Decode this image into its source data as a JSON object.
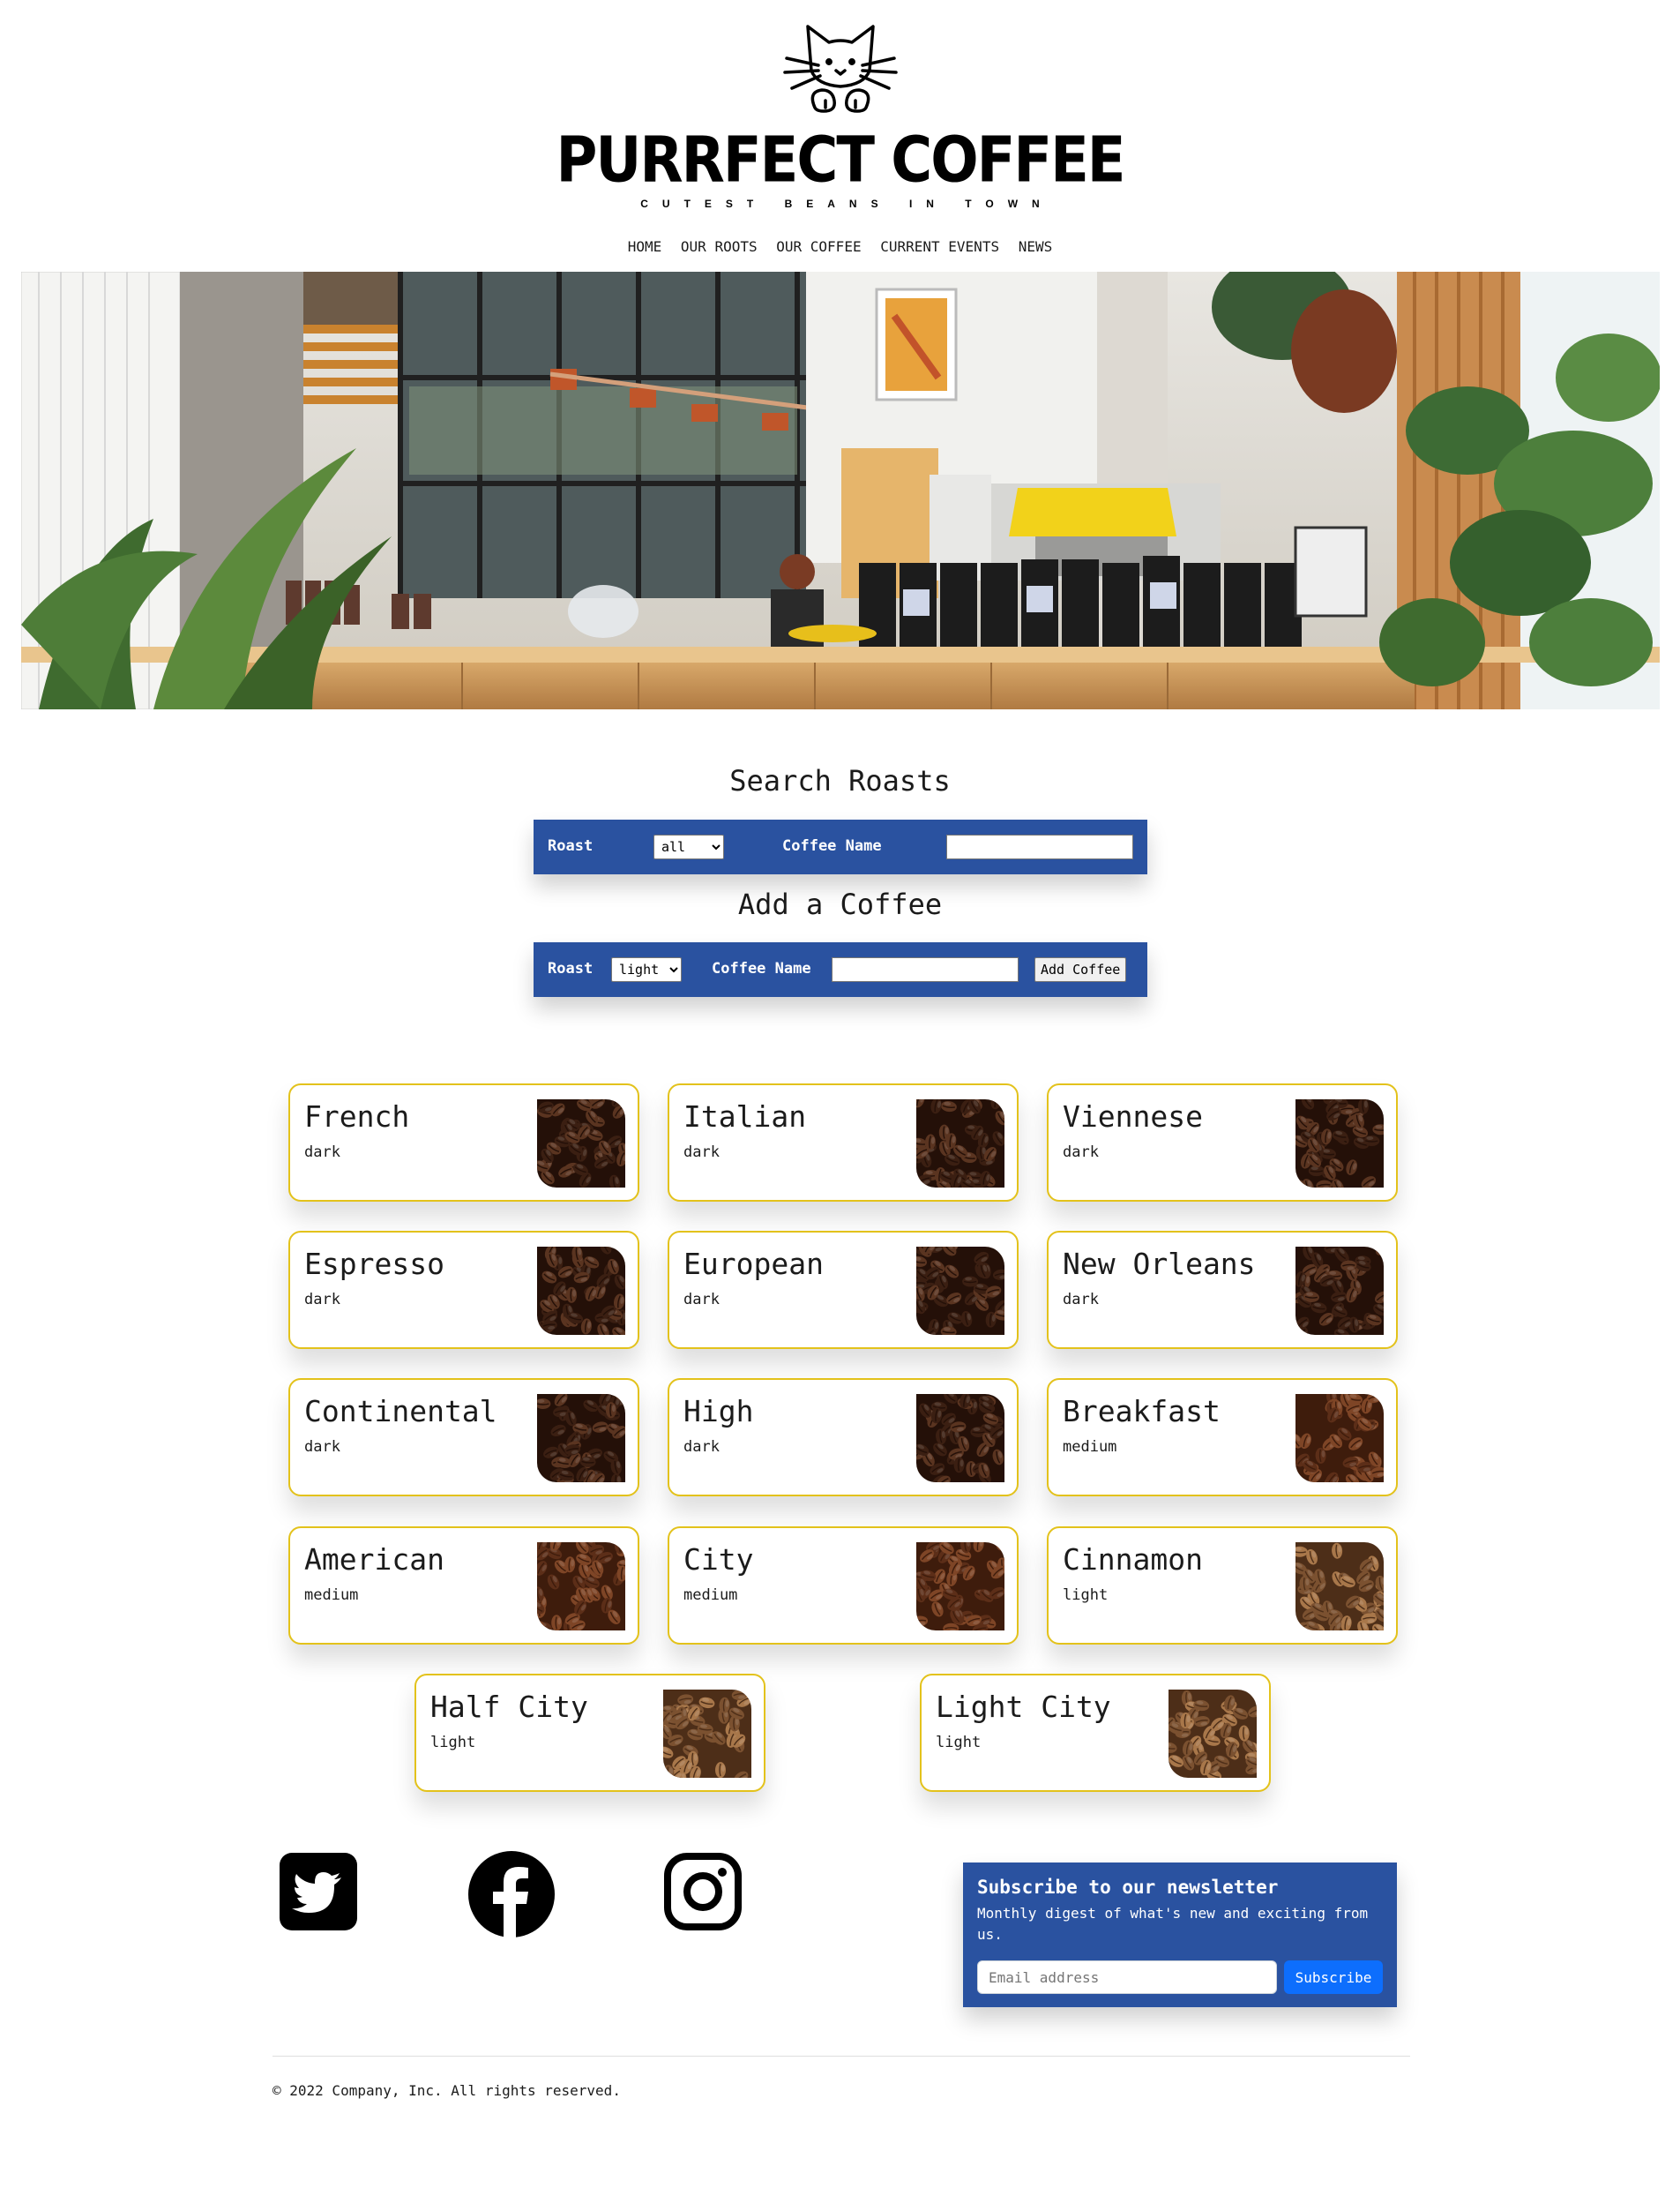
{
  "brand": {
    "name": "PURRFECT COFFEE",
    "tagline": "CUTEST BEANS IN TOWN",
    "logo_icon": "cat-logo-icon"
  },
  "nav": [
    "HOME",
    "OUR ROOTS",
    "OUR COFFEE",
    "CURRENT EVENTS",
    "NEWS"
  ],
  "hero": {
    "image": "coffee-shop-interior"
  },
  "search": {
    "title": "Search Roasts",
    "roast_label": "Roast",
    "roast_value": "all",
    "name_label": "Coffee Name",
    "name_value": ""
  },
  "add": {
    "title": "Add a Coffee",
    "roast_label": "Roast",
    "roast_value": "light",
    "name_label": "Coffee Name",
    "name_value": "",
    "button": "Add Coffee"
  },
  "coffees": [
    {
      "name": "French",
      "roast": "dark"
    },
    {
      "name": "Italian",
      "roast": "dark"
    },
    {
      "name": "Viennese",
      "roast": "dark"
    },
    {
      "name": "Espresso",
      "roast": "dark"
    },
    {
      "name": "European",
      "roast": "dark"
    },
    {
      "name": "New Orleans",
      "roast": "dark"
    },
    {
      "name": "Continental",
      "roast": "dark"
    },
    {
      "name": "High",
      "roast": "dark"
    },
    {
      "name": "Breakfast",
      "roast": "medium"
    },
    {
      "name": "American",
      "roast": "medium"
    },
    {
      "name": "City",
      "roast": "medium"
    },
    {
      "name": "Cinnamon",
      "roast": "light"
    },
    {
      "name": "Half City",
      "roast": "light"
    },
    {
      "name": "Light City",
      "roast": "light"
    }
  ],
  "social": [
    "twitter-icon",
    "facebook-icon",
    "instagram-icon"
  ],
  "newsletter": {
    "title": "Subscribe to our newsletter",
    "description": "Monthly digest of what's new and exciting from us.",
    "email_placeholder": "Email address",
    "button": "Subscribe"
  },
  "footer": {
    "copyright": "© 2022 Company, Inc. All rights reserved."
  },
  "colors": {
    "accent_blue": "#2a52a0",
    "card_border": "#e3c21b",
    "subscribe_button": "#0d6efd"
  }
}
